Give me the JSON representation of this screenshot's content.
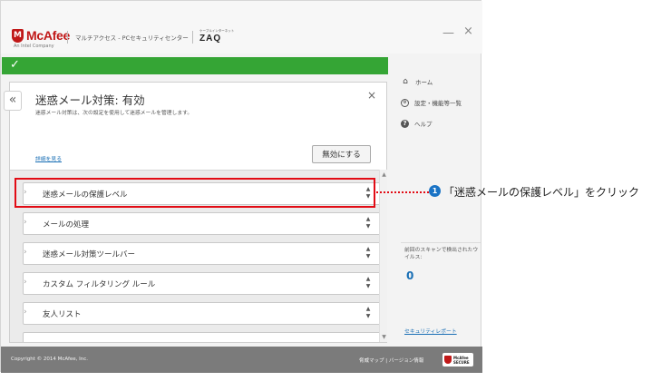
{
  "app": {
    "brand": "McAfee",
    "brand_sub": "An Intel Company",
    "suite_title": "マルチアクセス - PCセキュリティセンター",
    "partner_small": "ケーブルインターネット",
    "partner": "ZAQ",
    "minimize": "—",
    "close": "×"
  },
  "status": {
    "check": "✓"
  },
  "side_nav": [
    {
      "label": "ホーム",
      "icon": "home-icon"
    },
    {
      "label": "設定・機能等一覧",
      "icon": "gear-icon"
    },
    {
      "label": "ヘルプ",
      "icon": "help-icon"
    }
  ],
  "scan": {
    "text": "前回のスキャンで検出されたウイルス:",
    "count": "0",
    "link": "セキュリティレポート"
  },
  "panel": {
    "back": "«",
    "title": "迷惑メール対策: 有効",
    "subtitle": "迷惑メール対策は、次の設定を使用して迷惑メールを管理します。",
    "close": "×",
    "detail_link": "詳細を見る",
    "disable_button": "無効にする"
  },
  "list_items": [
    {
      "label": "迷惑メールの保護レベル"
    },
    {
      "label": "メールの処理"
    },
    {
      "label": "迷惑メール対策ツールバー"
    },
    {
      "label": "カスタム フィルタリング ルール"
    },
    {
      "label": "友人リスト"
    }
  ],
  "annotation": {
    "step": "1",
    "text": "「迷惑メールの保護レベル」をクリック",
    "highlight_color": "#e20c15",
    "badge_color": "#1a73c5"
  },
  "footer": {
    "copyright": "Copyright © 2014 McAfee, Inc.",
    "link_threat_map": "脅威マップ",
    "divider": " | ",
    "link_version": "バージョン情報",
    "secure_top": "McAfee",
    "secure_bottom": "SECURE"
  },
  "colors": {
    "brand": "#c01818",
    "status": "#35a535",
    "link": "#1a6fb5"
  }
}
